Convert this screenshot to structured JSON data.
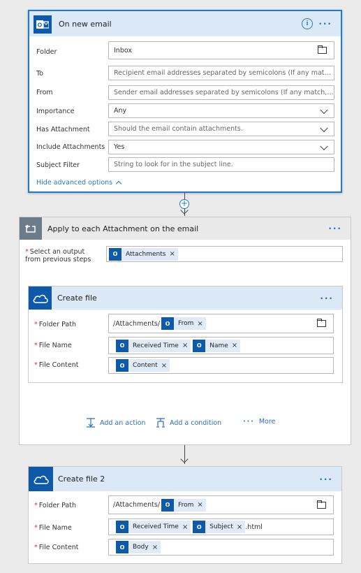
{
  "trigger": {
    "title": "On new email",
    "fields": [
      {
        "label": "Folder",
        "value": "Inbox"
      },
      {
        "label": "To",
        "placeholder": "Recipient email addresses separated by semicolons (If any match, the trigger will run)"
      },
      {
        "label": "From",
        "placeholder": "Sender email addresses separated by semicolons (If any match, the trigger will run)"
      },
      {
        "label": "Importance",
        "value": "Any"
      },
      {
        "label": "Has Attachment",
        "placeholder": "Should the email contain attachments."
      },
      {
        "label": "Include Attachments",
        "value": "Yes"
      },
      {
        "label": "Subject Filter",
        "placeholder": "String to look for in the subject line."
      }
    ],
    "advanced_link": "Hide advanced options"
  },
  "loop": {
    "title": "Apply to each Attachment on the email",
    "select_label_1": "Select an output",
    "select_label_2": "from previous steps",
    "select_token": "Attachments"
  },
  "create_file": {
    "title": "Create file",
    "folder_label": "Folder Path",
    "folder_prefix": "/Attachments/",
    "folder_token": "From",
    "name_label": "File Name",
    "name_tokens": [
      "Received Time",
      "Name"
    ],
    "content_label": "File Content",
    "content_token": "Content"
  },
  "actions": {
    "add_action": "Add an action",
    "add_condition": "Add a condition",
    "more": "More"
  },
  "create_file_2": {
    "title": "Create file 2",
    "folder_label": "Folder Path",
    "folder_prefix": "/Attachments/",
    "folder_token": "From",
    "name_label": "File Name",
    "name_tokens": [
      "Received Time",
      "Subject"
    ],
    "name_suffix": ".html",
    "content_label": "File Content",
    "content_token": "Body"
  },
  "colors": {
    "accent": "#1f7ac7",
    "outlook_blue": "#0f5aa8",
    "trigger_header": "#dbe8f5",
    "loop_header": "#e9e9e9",
    "required": "#d13438"
  }
}
